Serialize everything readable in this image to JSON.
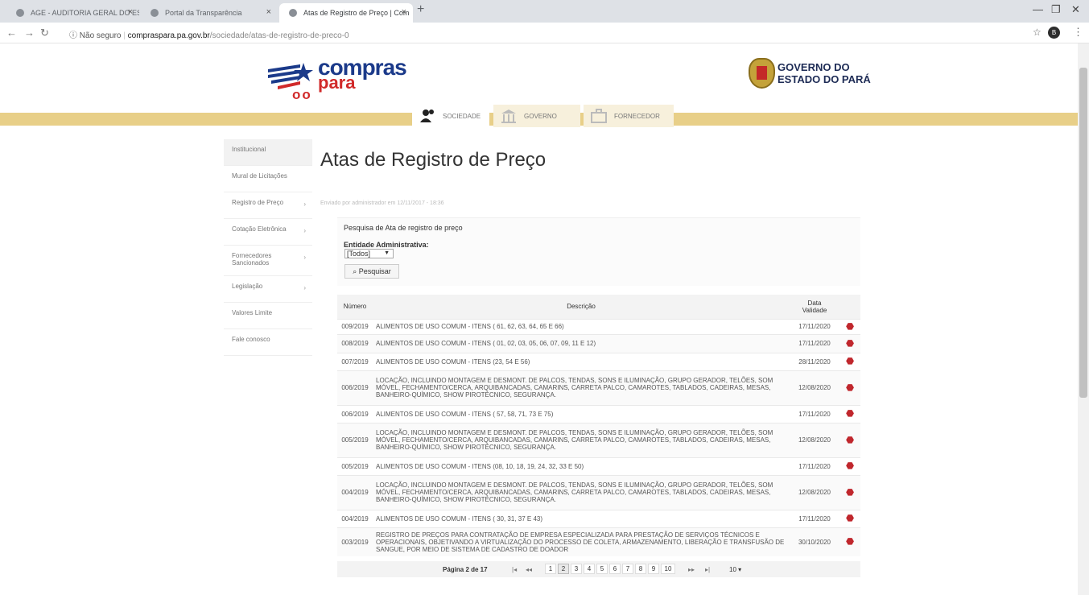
{
  "browser": {
    "tabs": [
      {
        "label": "AGE - AUDITORIA GERAL DO ES",
        "active": false
      },
      {
        "label": "Portal da Transparência",
        "active": false
      },
      {
        "label": "Atas de Registro de Preço | Com",
        "active": true
      }
    ],
    "address": {
      "security": "Não seguro",
      "host": "compraspara.pa.gov.br",
      "path": "/sociedade/atas-de-registro-de-preco-0"
    },
    "profile_initial": "B"
  },
  "header": {
    "logo_compras": "compras",
    "logo_para": "para",
    "gov_line1": "GOVERNO DO",
    "gov_line2": "ESTADO DO PARÁ"
  },
  "nav": {
    "sociedade": "SOCIEDADE",
    "governo": "GOVERNO",
    "fornecedor": "FORNECEDOR"
  },
  "sidebar": {
    "items": [
      {
        "label": "Institucional",
        "arrow": false
      },
      {
        "label": "Mural de Licitações",
        "arrow": false
      },
      {
        "label": "Registro de Preço",
        "arrow": true
      },
      {
        "label": "Cotação Eletrônica",
        "arrow": true
      },
      {
        "label": "Fornecedores Sancionados",
        "arrow": true
      },
      {
        "label": "Legislação",
        "arrow": true
      },
      {
        "label": "Valores Limite",
        "arrow": false
      },
      {
        "label": "Fale conosco",
        "arrow": false
      }
    ]
  },
  "main": {
    "title": "Atas de Registro de Preço",
    "meta": "Enviado por administrador em 12/11/2017 - 18:36"
  },
  "search": {
    "header": "Pesquisa de Ata de registro de preço",
    "entity_label": "Entidade Administrativa:",
    "entity_value": "[Todos]",
    "button": "Pesquisar"
  },
  "table": {
    "headers": {
      "numero": "Número",
      "descricao": "Descrição",
      "data1": "Data",
      "data2": "Validade"
    },
    "rows": [
      {
        "num": "009/2019",
        "desc": "ALIMENTOS DE USO COMUM - ITENS ( 61, 62, 63, 64, 65 E 66)",
        "date": "17/11/2020"
      },
      {
        "num": "008/2019",
        "desc": "ALIMENTOS DE USO COMUM - ITENS ( 01, 02, 03, 05, 06, 07, 09, 11 E 12)",
        "date": "17/11/2020"
      },
      {
        "num": "007/2019",
        "desc": "ALIMENTOS DE USO COMUM - ITENS (23, 54 E 56)",
        "date": "28/11/2020"
      },
      {
        "num": "006/2019",
        "desc": "LOCAÇÃO, INCLUINDO MONTAGEM E DESMONT. DE PALCOS, TENDAS, SONS E ILUMINAÇÃO, GRUPO GERADOR, TELÕES, SOM MÓVEL, FECHAMENTO/CERCA, ARQUIBANCADAS, CAMARINS, CARRETA PALCO, CAMAROTES, TABLADOS, CADEIRAS, MESAS, BANHEIRO-QUÍMICO, SHOW PIROTÉCNICO, SEGURANÇA.",
        "date": "12/08/2020"
      },
      {
        "num": "006/2019",
        "desc": "ALIMENTOS DE USO COMUM - ITENS ( 57, 58, 71, 73 E 75)",
        "date": "17/11/2020"
      },
      {
        "num": "005/2019",
        "desc": "LOCAÇÃO, INCLUINDO MONTAGEM E DESMONT. DE PALCOS, TENDAS, SONS E ILUMINAÇÃO, GRUPO GERADOR, TELÕES, SOM MÓVEL, FECHAMENTO/CERCA, ARQUIBANCADAS, CAMARINS, CARRETA PALCO, CAMAROTES, TABLADOS, CADEIRAS, MESAS, BANHEIRO-QUÍMICO, SHOW PIROTÉCNICO, SEGURANÇA.",
        "date": "12/08/2020"
      },
      {
        "num": "005/2019",
        "desc": "ALIMENTOS DE USO COMUM - ITENS (08, 10, 18, 19, 24, 32, 33 E 50)",
        "date": "17/11/2020"
      },
      {
        "num": "004/2019",
        "desc": "LOCAÇÃO, INCLUINDO MONTAGEM E DESMONT. DE PALCOS, TENDAS, SONS E ILUMINAÇÃO, GRUPO GERADOR, TELÕES, SOM MÓVEL, FECHAMENTO/CERCA, ARQUIBANCADAS, CAMARINS, CARRETA PALCO, CAMAROTES, TABLADOS, CADEIRAS, MESAS, BANHEIRO-QUÍMICO, SHOW PIROTÉCNICO, SEGURANÇA.",
        "date": "12/08/2020"
      },
      {
        "num": "004/2019",
        "desc": "ALIMENTOS DE USO COMUM - ITENS ( 30, 31, 37 E 43)",
        "date": "17/11/2020"
      },
      {
        "num": "003/2019",
        "desc": "REGISTRO DE PREÇOS PARA CONTRATAÇÃO DE EMPRESA ESPECIALIZADA PARA PRESTAÇÃO DE SERVIÇOS TÉCNICOS E OPERACIONAIS, OBJETIVANDO A VIRTUALIZAÇÃO DO PROCESSO DE COLETA, ARMAZENAMENTO, LIBERAÇÃO E TRANSFUSÃO DE SANGUE, POR MEIO DE SISTEMA DE CADASTRO DE DOADOR",
        "date": "30/10/2020"
      }
    ]
  },
  "pager": {
    "info": "Página 2 de 17",
    "first": "|◂",
    "prev": "◂◂",
    "pages": [
      "1",
      "2",
      "3",
      "4",
      "5",
      "6",
      "7",
      "8",
      "9",
      "10"
    ],
    "current": "2",
    "next": "▸▸",
    "last": "▸|",
    "size": "10 ▾"
  }
}
